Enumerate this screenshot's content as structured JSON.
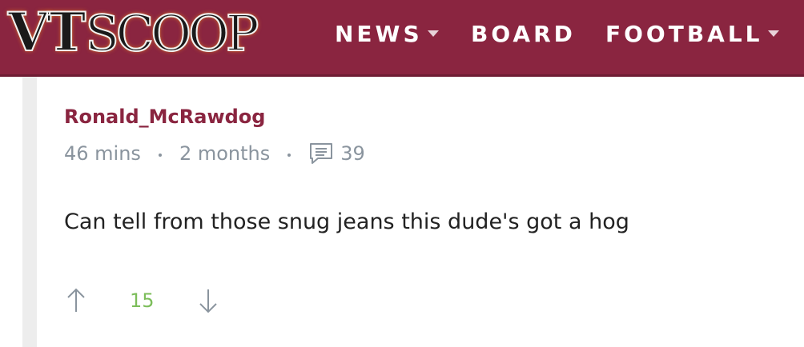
{
  "header": {
    "logo_vt": "VT",
    "logo_scoop": "SCOOP",
    "nav": [
      {
        "label": "NEWS",
        "has_dropdown": true
      },
      {
        "label": "BOARD",
        "has_dropdown": false
      },
      {
        "label": "FOOTBALL",
        "has_dropdown": true
      }
    ],
    "background_color": "#8a2540"
  },
  "comment": {
    "author": "Ronald_McRawdog",
    "posted_ago": "46 mins",
    "account_age": "2 months",
    "reply_count": "39",
    "reply_icon": "comment-icon",
    "text": "Can tell from those snug jeans this dude's got a hog",
    "score": "15",
    "upvote_icon": "arrow-up-icon",
    "downvote_icon": "arrow-down-icon",
    "author_color": "#8a2540",
    "score_color": "#7cbd5a"
  }
}
